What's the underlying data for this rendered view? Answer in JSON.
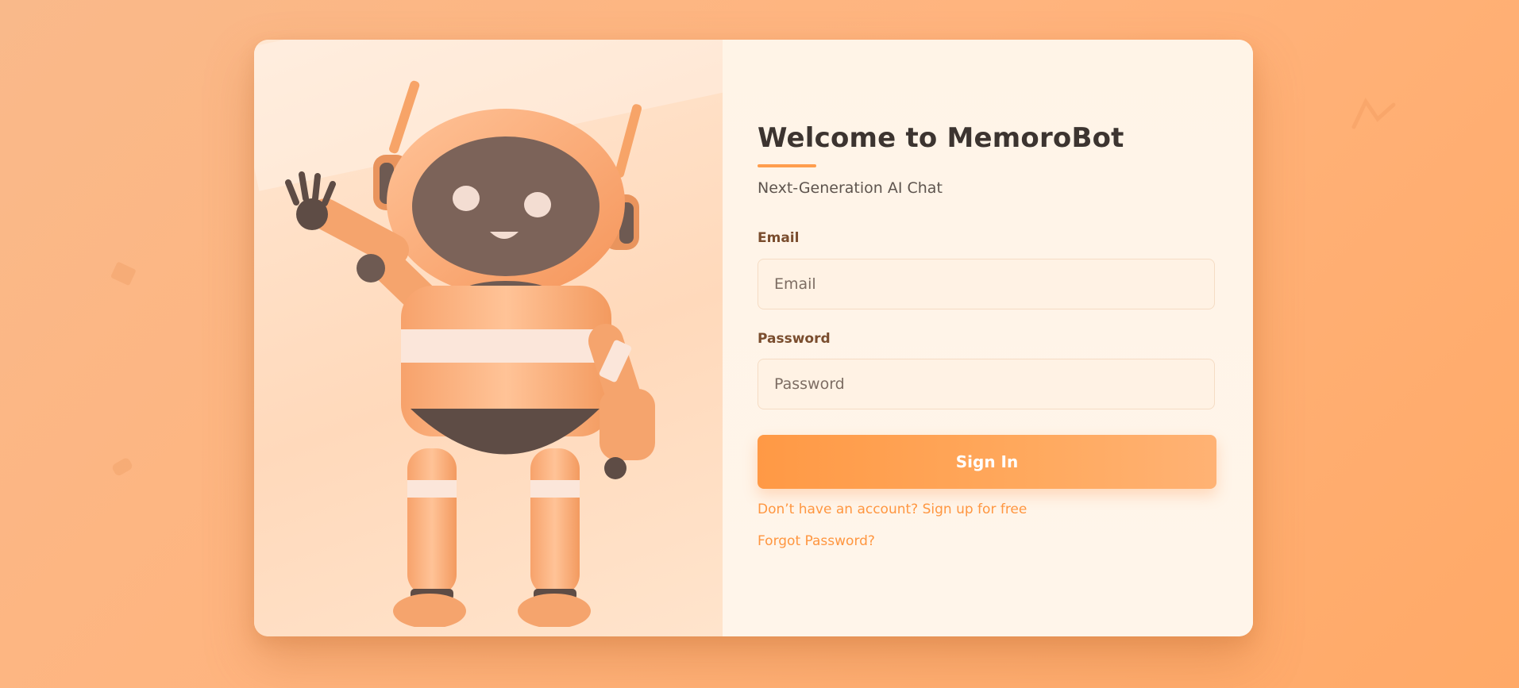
{
  "login": {
    "title": "Welcome to MemoroBot",
    "subtitle": "Next-Generation AI Chat",
    "email_label": "Email",
    "email_placeholder": "Email",
    "email_value": "",
    "password_label": "Password",
    "password_placeholder": "Password",
    "password_value": "",
    "signin_label": "Sign In",
    "signup_link": "Don’t have an account? Sign up for free",
    "forgot_link": "Forgot Password?"
  },
  "illustration": {
    "icon": "waving-robot-illustration"
  },
  "colors": {
    "accent": "#ff9d4d",
    "background": "#ffb47e",
    "card": "#fff4e7",
    "title_text": "#3c3430",
    "label_text": "#7a4d2e",
    "link_text": "#ff9640"
  }
}
